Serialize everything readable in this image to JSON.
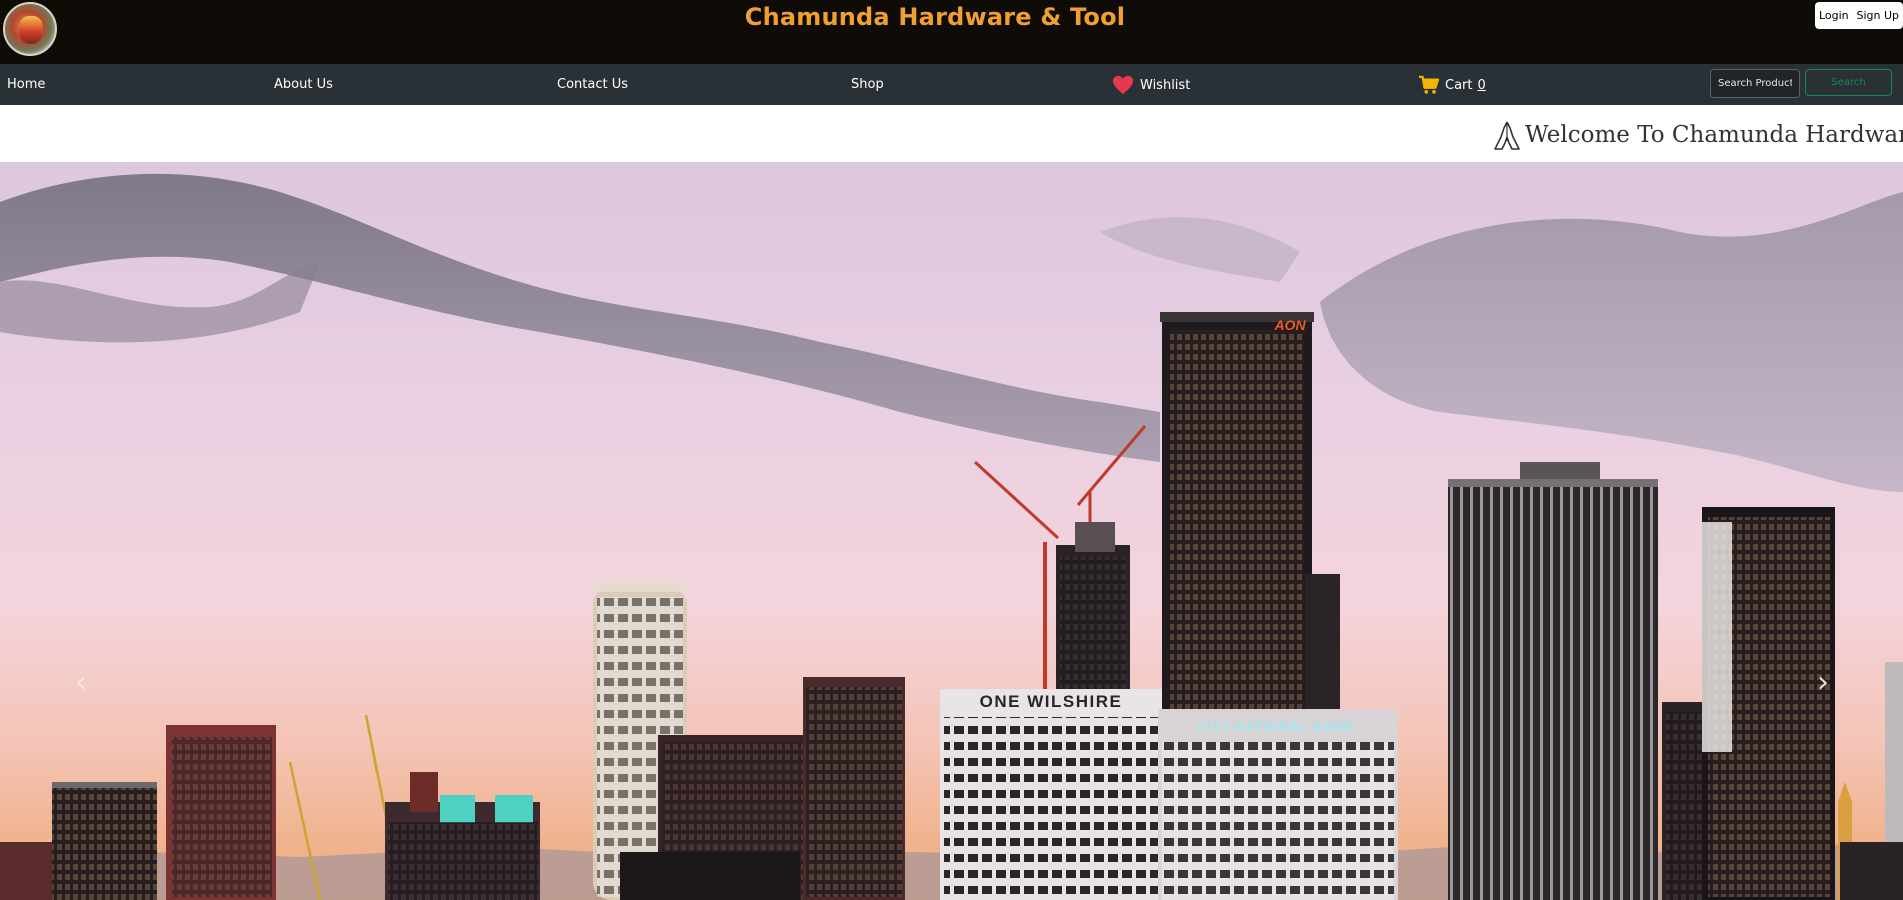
{
  "header": {
    "title": "Chamunda Hardware & Tool",
    "login_label": "Login",
    "signup_label": "Sign Up",
    "title_color": "#f0a030"
  },
  "nav": {
    "home": "Home",
    "about": "About Us",
    "contact": "Contact Us",
    "shop": "Shop",
    "wishlist": "Wishlist",
    "cart": "Cart",
    "cart_count": "0",
    "search_placeholder": "Search Products",
    "search_button": "Search"
  },
  "marquee": {
    "text": "Welcome To Chamunda Hardware &"
  },
  "hero": {
    "sign_one_wilshire": "ONE WILSHIRE",
    "sign_city_national": "CITY NATIONAL BANK",
    "sign_aon": "AON",
    "prev_icon": "chevron-left-icon",
    "next_icon": "chevron-right-icon"
  },
  "icons": {
    "wishlist": "heart-icon",
    "cart": "cart-icon",
    "marquee": "praying-hands-icon"
  },
  "colors": {
    "topbar_bg": "#0f0c07",
    "navbar_bg": "#2a3136",
    "heart": "#e8384f",
    "cart": "#f5b400",
    "search_accent": "#198754"
  }
}
